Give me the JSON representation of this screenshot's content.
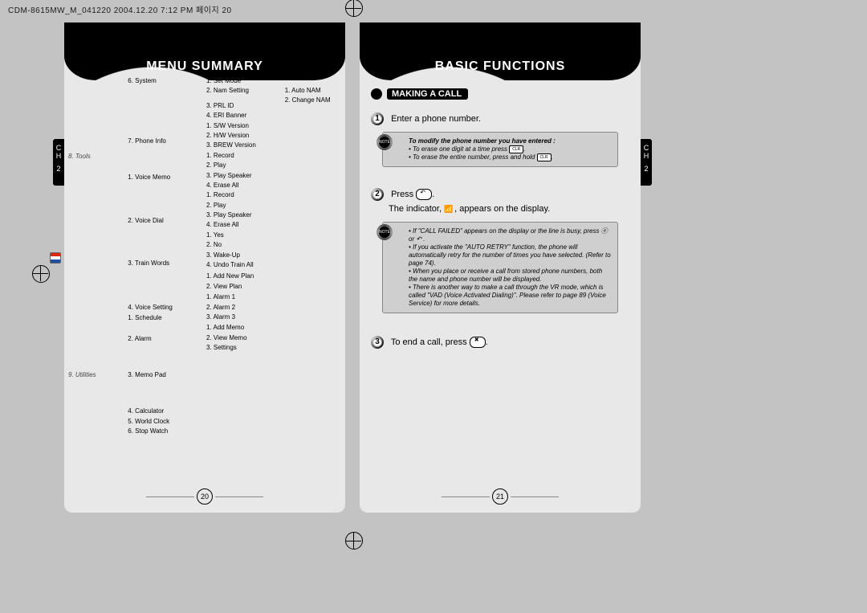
{
  "doc_header": "CDM-8615MW_M_041220  2004.12.20  7:12 PM  페이지 20",
  "left_page": {
    "title": "MENU SUMMARY",
    "side_tab": {
      "line1": "C",
      "line2": "H",
      "line3": "2"
    },
    "cols": {
      "col1": [
        {
          "text": "8. Tools",
          "cls": "menu-header"
        },
        {
          "text": ""
        },
        {
          "text": ""
        },
        {
          "text": ""
        },
        {
          "text": ""
        },
        {
          "text": ""
        },
        {
          "text": ""
        },
        {
          "text": ""
        },
        {
          "text": ""
        },
        {
          "text": ""
        },
        {
          "text": ""
        },
        {
          "text": ""
        },
        {
          "text": ""
        },
        {
          "text": ""
        },
        {
          "text": "9. Utilities",
          "cls": "menu-header"
        }
      ],
      "col2": [
        {
          "text": "6. System"
        },
        {
          "text": ""
        },
        {
          "text": ""
        },
        {
          "text": "7. Phone Info"
        },
        {
          "text": ""
        },
        {
          "text": ""
        },
        {
          "text": "1. Voice Memo"
        },
        {
          "text": ""
        },
        {
          "text": ""
        },
        {
          "text": "2. Voice Dial"
        },
        {
          "text": ""
        },
        {
          "text": ""
        },
        {
          "text": "3. Train Words"
        },
        {
          "text": ""
        },
        {
          "text": ""
        },
        {
          "text": "4. Voice Setting"
        },
        {
          "text": "1. Schedule"
        },
        {
          "text": ""
        },
        {
          "text": "2. Alarm"
        },
        {
          "text": ""
        },
        {
          "text": ""
        },
        {
          "text": "3. Memo Pad"
        },
        {
          "text": ""
        },
        {
          "text": ""
        },
        {
          "text": "4. Calculator"
        },
        {
          "text": "5. World Clock"
        },
        {
          "text": "6. Stop Watch"
        }
      ],
      "col3": [
        {
          "text": "1. Set Mode"
        },
        {
          "text": "2. Nam Setting"
        },
        {
          "text": "3. PRL ID"
        },
        {
          "text": "4. ERI Banner"
        },
        {
          "text": "1. S/W Version"
        },
        {
          "text": "2. H/W Version"
        },
        {
          "text": "3. BREW Version"
        },
        {
          "text": "1. Record"
        },
        {
          "text": "2. Play"
        },
        {
          "text": "3. Play Speaker"
        },
        {
          "text": "4. Erase All"
        },
        {
          "text": "1. Record"
        },
        {
          "text": "2. Play"
        },
        {
          "text": "3. Play Speaker"
        },
        {
          "text": "4. Erase All"
        },
        {
          "text": "1. Yes"
        },
        {
          "text": "2. No"
        },
        {
          "text": "3. Wake-Up"
        },
        {
          "text": "4. Undo Train All"
        },
        {
          "text": "1. Add New Plan"
        },
        {
          "text": "2. View Plan"
        },
        {
          "text": "1. Alarm 1"
        },
        {
          "text": "2. Alarm 2"
        },
        {
          "text": "3. Alarm 3"
        },
        {
          "text": "1. Add Memo"
        },
        {
          "text": "2. View Memo"
        },
        {
          "text": "3. Settings"
        }
      ],
      "col4": [
        {
          "text": "1. Auto NAM"
        },
        {
          "text": "2. Change NAM"
        }
      ]
    },
    "page_number": "20"
  },
  "right_page": {
    "title": "BASIC FUNCTIONS",
    "side_tab": {
      "line1": "C",
      "line2": "H",
      "line3": "2"
    },
    "section": "MAKING A CALL",
    "steps": {
      "s1_num": "1",
      "s1_text": "Enter a phone number.",
      "s2_num": "2",
      "s2_text_a": "Press",
      "s2_text_b": ".",
      "s2_text_c": "The indicator,",
      "s2_text_d": ", appears on the display.",
      "s3_num": "3",
      "s3_text_a": "To end a call, press",
      "s3_text_b": "."
    },
    "note1": {
      "heading": "To modify the phone number you have entered :",
      "line1a": "To erase one digit at a time press",
      "line1b": ".",
      "line2a": "To erase the entire number, press and hold",
      "line2b": "."
    },
    "note2": {
      "b1": "If \"CALL FAILED\" appears on the display or the line is busy, press ⓔ or ↶ .",
      "b2": "If you activate the \"AUTO RETRY\" function, the phone will automatically retry for the number of times you have selected. (Refer to page 74).",
      "b3": "When you place or receive a call from stored phone numbers, both the name and phone number will be displayed.",
      "b4": "There is another way to make a call through the VR mode, which is called \"VAD (Voice Activated Dialing)\". Please refer to page 89 (Voice Service) for more details."
    },
    "page_number": "21"
  }
}
